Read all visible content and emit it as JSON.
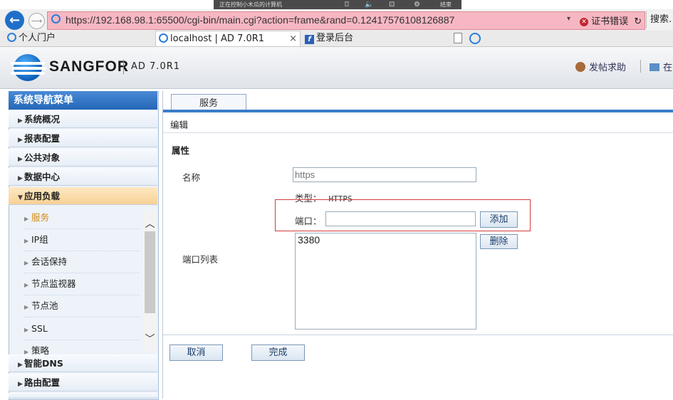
{
  "remote_bar": {
    "title": "正在控制小木瓜的计算机",
    "end_label": "结束"
  },
  "address_bar": {
    "url": "https://192.168.98.1:65500/cgi-bin/main.cgi?action=frame&rand=0.12417576108126887",
    "cert_error": "证书错误",
    "search_label": "搜索."
  },
  "tabs": [
    {
      "label": "个人门户"
    },
    {
      "label": "localhost | AD 7.0R1"
    },
    {
      "label": "登录后台"
    }
  ],
  "header": {
    "brand": "SANGFOR",
    "version": "AD 7.0R1",
    "help_label": "发帖求助",
    "more_label": "在"
  },
  "sidebar": {
    "title": "系统导航菜单",
    "categories": [
      {
        "label": "系统概况"
      },
      {
        "label": "报表配置"
      },
      {
        "label": "公共对象"
      },
      {
        "label": "数据中心"
      },
      {
        "label": "应用负载"
      },
      {
        "label": "智能DNS"
      },
      {
        "label": "路由配置"
      }
    ],
    "subitems": [
      {
        "label": "服务"
      },
      {
        "label": "IP组"
      },
      {
        "label": "会话保持"
      },
      {
        "label": "节点监视器"
      },
      {
        "label": "节点池"
      },
      {
        "label": "SSL"
      },
      {
        "label": "策略"
      }
    ]
  },
  "content": {
    "tab_label": "服务",
    "edit_label": "编辑",
    "section_title": "属性",
    "name_label": "名称",
    "name_placeholder": "https",
    "type_label": "类型：",
    "type_value": "HTTPS",
    "port_label": "端口：",
    "port_value": "",
    "add_button": "添加",
    "port_list_label": "端口列表",
    "port_list_value": "3380",
    "delete_button": "删除",
    "cancel_button": "取消",
    "finish_button": "完成"
  }
}
